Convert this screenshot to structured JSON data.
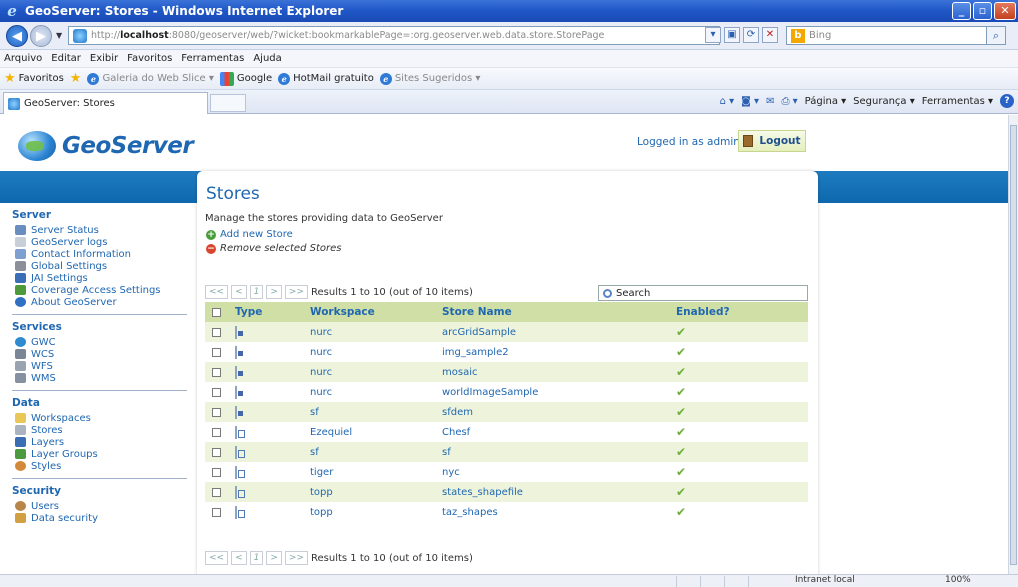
{
  "window": {
    "title": "GeoServer: Stores - Windows Internet Explorer",
    "controls": [
      "_",
      "▫",
      "✕"
    ]
  },
  "address": {
    "url_prefix": "http://",
    "url_host": "localhost",
    "url_rest": ":8080/geoserver/web/?wicket:bookmarkablePage=:org.geoserver.web.data.store.StorePage",
    "search_placeholder": "Bing"
  },
  "menu": [
    "Arquivo",
    "Editar",
    "Exibir",
    "Favoritos",
    "Ferramentas",
    "Ajuda"
  ],
  "favorites": {
    "label": "Favoritos",
    "items": [
      "Galeria do Web Slice ▾",
      "Google",
      "HotMail gratuito",
      "Sites Sugeridos ▾"
    ]
  },
  "tab": {
    "title": "GeoServer: Stores"
  },
  "commands": [
    "Página ▾",
    "Segurança ▾",
    "Ferramentas ▾"
  ],
  "status": {
    "zone": "Intranet local",
    "zoom": "100%"
  },
  "header": {
    "logo_text": "GeoServer",
    "logged_in": "Logged in as admin.",
    "logout": "Logout"
  },
  "sidebar": {
    "sections": [
      {
        "title": "Server",
        "items": [
          {
            "label": "Server Status",
            "color": "#6a8dbf"
          },
          {
            "label": "GeoServer logs",
            "color": "#c9cfd8"
          },
          {
            "label": "Contact Information",
            "color": "#7da0d0"
          },
          {
            "label": "Global Settings",
            "color": "#8b8f99"
          },
          {
            "label": "JAI Settings",
            "color": "#3a6fb8"
          },
          {
            "label": "Coverage Access Settings",
            "color": "#4e9a3a"
          },
          {
            "label": "About GeoServer",
            "color": "#2f6fc4"
          }
        ]
      },
      {
        "title": "Services",
        "items": [
          {
            "label": "GWC",
            "color": "#2e8bd0"
          },
          {
            "label": "WCS",
            "color": "#7a8596"
          },
          {
            "label": "WFS",
            "color": "#9aa3b0"
          },
          {
            "label": "WMS",
            "color": "#8590a0"
          }
        ]
      },
      {
        "title": "Data",
        "items": [
          {
            "label": "Workspaces",
            "color": "#e8c657"
          },
          {
            "label": "Stores",
            "color": "#aab3c0"
          },
          {
            "label": "Layers",
            "color": "#3b6db5"
          },
          {
            "label": "Layer Groups",
            "color": "#4c9a3f"
          },
          {
            "label": "Styles",
            "color": "#d28a3a"
          }
        ]
      },
      {
        "title": "Security",
        "items": [
          {
            "label": "Users",
            "color": "#b8864a"
          },
          {
            "label": "Data security",
            "color": "#d2a040"
          }
        ]
      }
    ]
  },
  "main": {
    "title": "Stores",
    "description": "Manage the stores providing data to GeoServer",
    "add": "Add new Store",
    "remove": "Remove selected Stores",
    "pager": {
      "first": "<<",
      "prev": "<",
      "page": "1",
      "next": ">",
      "last": ">>",
      "results": "Results 1 to 10 (out of 10 items)"
    },
    "search_label": "Search",
    "columns": {
      "type": "Type",
      "workspace": "Workspace",
      "name": "Store Name",
      "enabled": "Enabled?"
    },
    "rows": [
      {
        "type": "raster",
        "workspace": "nurc",
        "name": "arcGridSample",
        "enabled": "✔"
      },
      {
        "type": "raster",
        "workspace": "nurc",
        "name": "img_sample2",
        "enabled": "✔"
      },
      {
        "type": "raster",
        "workspace": "nurc",
        "name": "mosaic",
        "enabled": "✔"
      },
      {
        "type": "raster",
        "workspace": "nurc",
        "name": "worldImageSample",
        "enabled": "✔"
      },
      {
        "type": "raster",
        "workspace": "sf",
        "name": "sfdem",
        "enabled": "✔"
      },
      {
        "type": "vector",
        "workspace": "Ezequiel",
        "name": "Chesf",
        "enabled": "✔"
      },
      {
        "type": "vector",
        "workspace": "sf",
        "name": "sf",
        "enabled": "✔"
      },
      {
        "type": "vector",
        "workspace": "tiger",
        "name": "nyc",
        "enabled": "✔"
      },
      {
        "type": "vector",
        "workspace": "topp",
        "name": "states_shapefile",
        "enabled": "✔"
      },
      {
        "type": "vector",
        "workspace": "topp",
        "name": "taz_shapes",
        "enabled": "✔"
      }
    ]
  }
}
